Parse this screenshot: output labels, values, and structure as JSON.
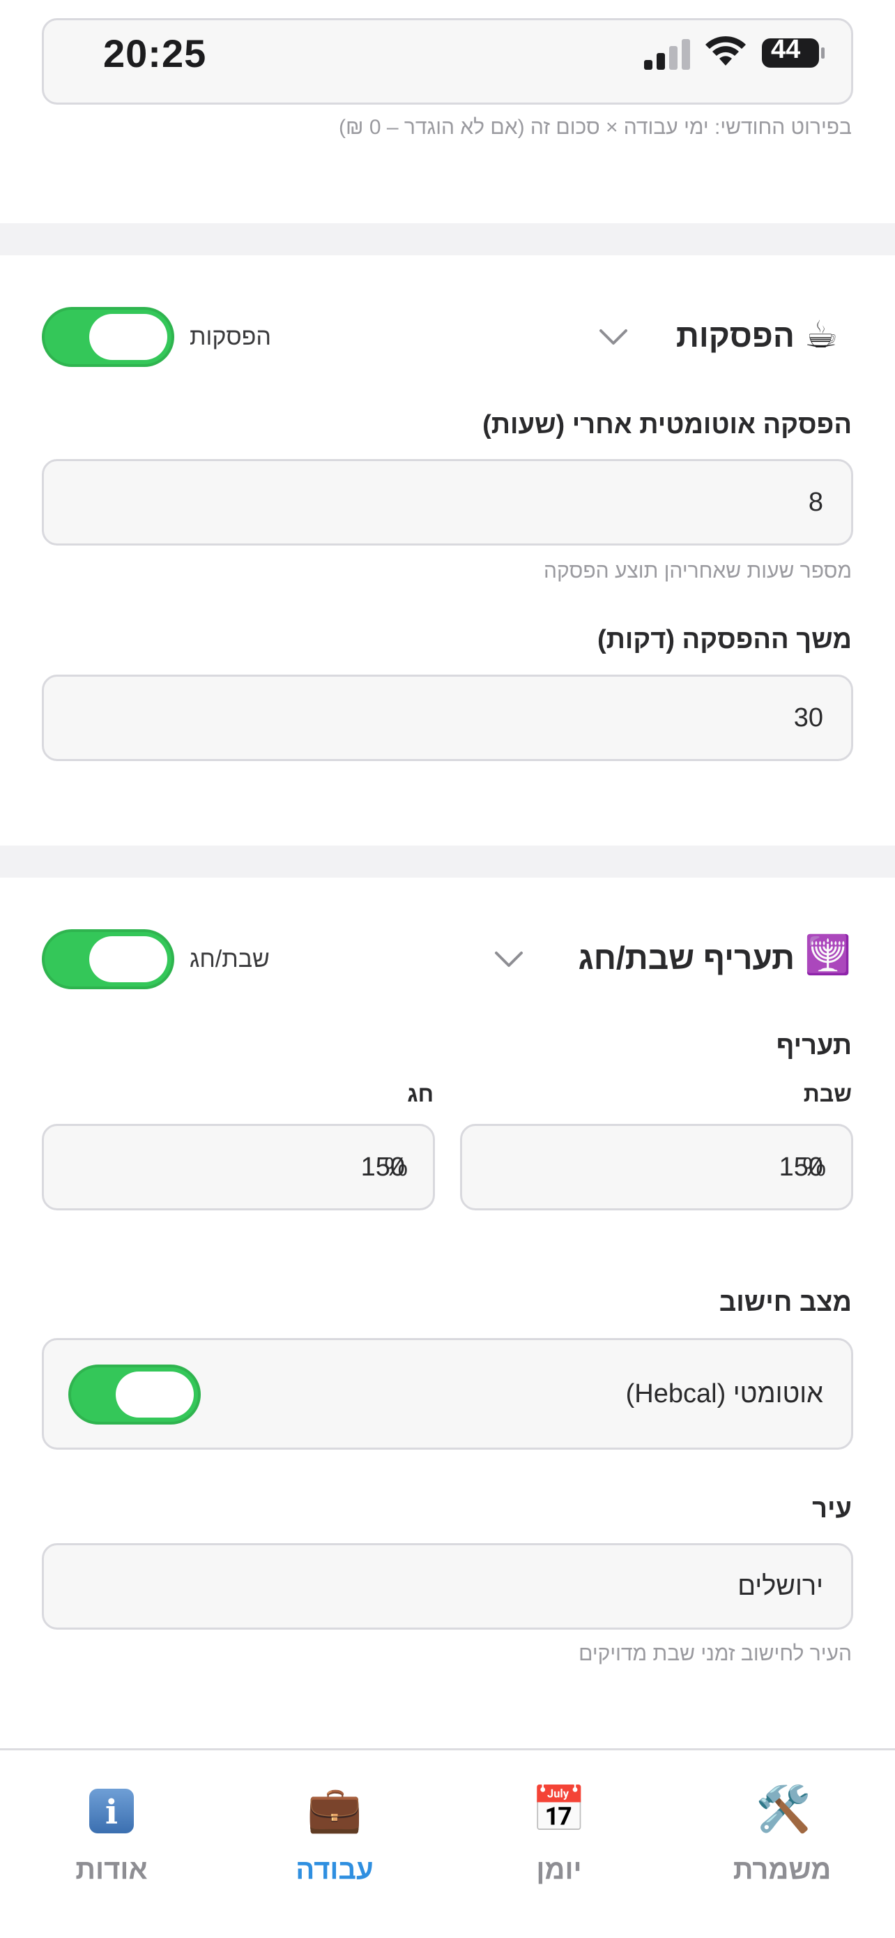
{
  "status_bar": {
    "time": "20:25",
    "battery": "44",
    "icons": [
      "signal-bars-icon",
      "wifi-icon",
      "battery-icon"
    ]
  },
  "top_hint": "בפירוט החודשי: ימי עבודה × סכום זה (אם לא הוגדר – 0 ₪)",
  "breaks_section": {
    "icon": "☕",
    "title": "הפסקות",
    "toggle_label": "הפסקות",
    "toggle_on": true,
    "auto_break_label": "הפסקה אוטומטית אחרי (שעות)",
    "auto_break_value": "8",
    "auto_break_hint": "מספר שעות שאחריהן תוצע הפסקה",
    "duration_label": "משך ההפסקה (דקות)",
    "duration_value": "30"
  },
  "shabbat_section": {
    "icon": "🕎",
    "title": "תעריף שבת/חג",
    "toggle_label": "שבת/חג",
    "toggle_on": true,
    "rate_label": "תעריף",
    "shabbat_label": "שבת",
    "shabbat_value": "150",
    "holiday_label": "חג",
    "holiday_value": "150",
    "unit": "%",
    "calc_mode_label": "מצב חישוב",
    "calc_mode_value": "אוטומטי (Hebcal)",
    "calc_mode_on": true,
    "city_label": "עיר",
    "city_value": "ירושלים",
    "city_hint": "העיר לחישוב זמני שבת מדויקים"
  },
  "tabs": [
    {
      "label": "משמרת",
      "icon": "🛠️",
      "icon_name": "tools-icon",
      "active": false
    },
    {
      "label": "יומן",
      "icon": "📅",
      "icon_name": "calendar-icon",
      "active": false
    },
    {
      "label": "עבודה",
      "icon": "💼",
      "icon_name": "briefcase-icon",
      "active": true
    },
    {
      "label": "אודות",
      "icon": "ℹ️",
      "icon_name": "info-icon",
      "active": false
    }
  ],
  "colors": {
    "toggle_green": "#34c759",
    "active_tab_blue": "#2f8fe0",
    "inactive_tab_gray": "#8e8e93"
  }
}
